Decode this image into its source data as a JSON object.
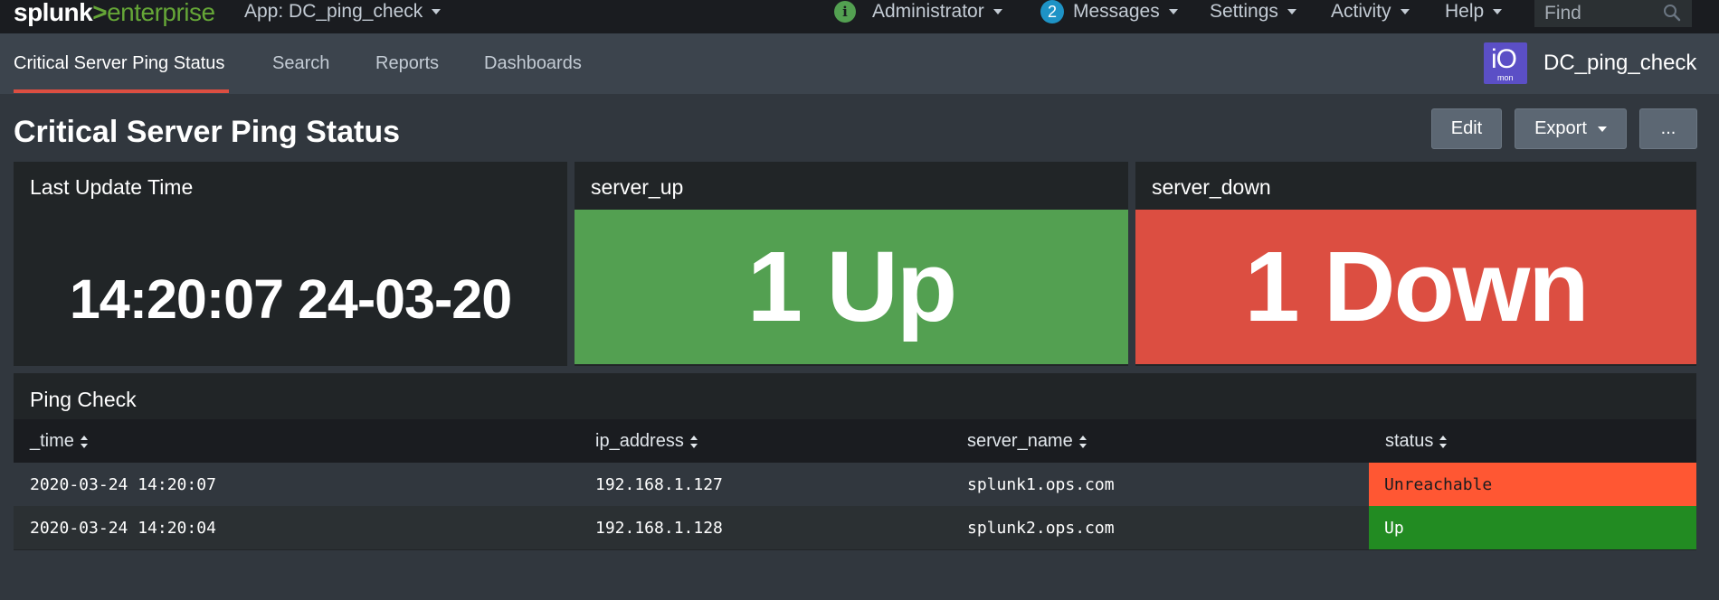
{
  "topbar": {
    "logo_text": "splunk",
    "logo_gt": ">",
    "logo_suffix": "enterprise",
    "app_menu": "App: DC_ping_check",
    "administrator": "Administrator",
    "info_badge": "i",
    "messages_count": "2",
    "messages": "Messages",
    "settings": "Settings",
    "activity": "Activity",
    "help": "Help",
    "find_placeholder": "Find"
  },
  "appbar": {
    "tabs": [
      {
        "label": "Critical Server Ping Status",
        "active": true
      },
      {
        "label": "Search"
      },
      {
        "label": "Reports"
      },
      {
        "label": "Dashboards"
      }
    ],
    "app_icon_main": "iO",
    "app_icon_sub": "mon",
    "app_name": "DC_ping_check"
  },
  "dashboard": {
    "title": "Critical Server Ping Status",
    "edit_label": "Edit",
    "export_label": "Export",
    "more_label": "..."
  },
  "panels": {
    "last_update": {
      "title": "Last Update Time",
      "value": "14:20:07 24-03-20"
    },
    "server_up": {
      "title": "server_up",
      "value": "1 Up",
      "color": "#53a051"
    },
    "server_down": {
      "title": "server_down",
      "value": "1 Down",
      "color": "#dc4e41"
    }
  },
  "table": {
    "title": "Ping Check",
    "columns": [
      "_time",
      "ip_address",
      "server_name",
      "status"
    ],
    "rows": [
      {
        "time": "2020-03-24 14:20:07",
        "ip": "192.168.1.127",
        "server": "splunk1.ops.com",
        "status": "Unreachable",
        "status_color": "#ff5733"
      },
      {
        "time": "2020-03-24 14:20:04",
        "ip": "192.168.1.128",
        "server": "splunk2.ops.com",
        "status": "Up",
        "status_color": "#228b22"
      }
    ]
  }
}
